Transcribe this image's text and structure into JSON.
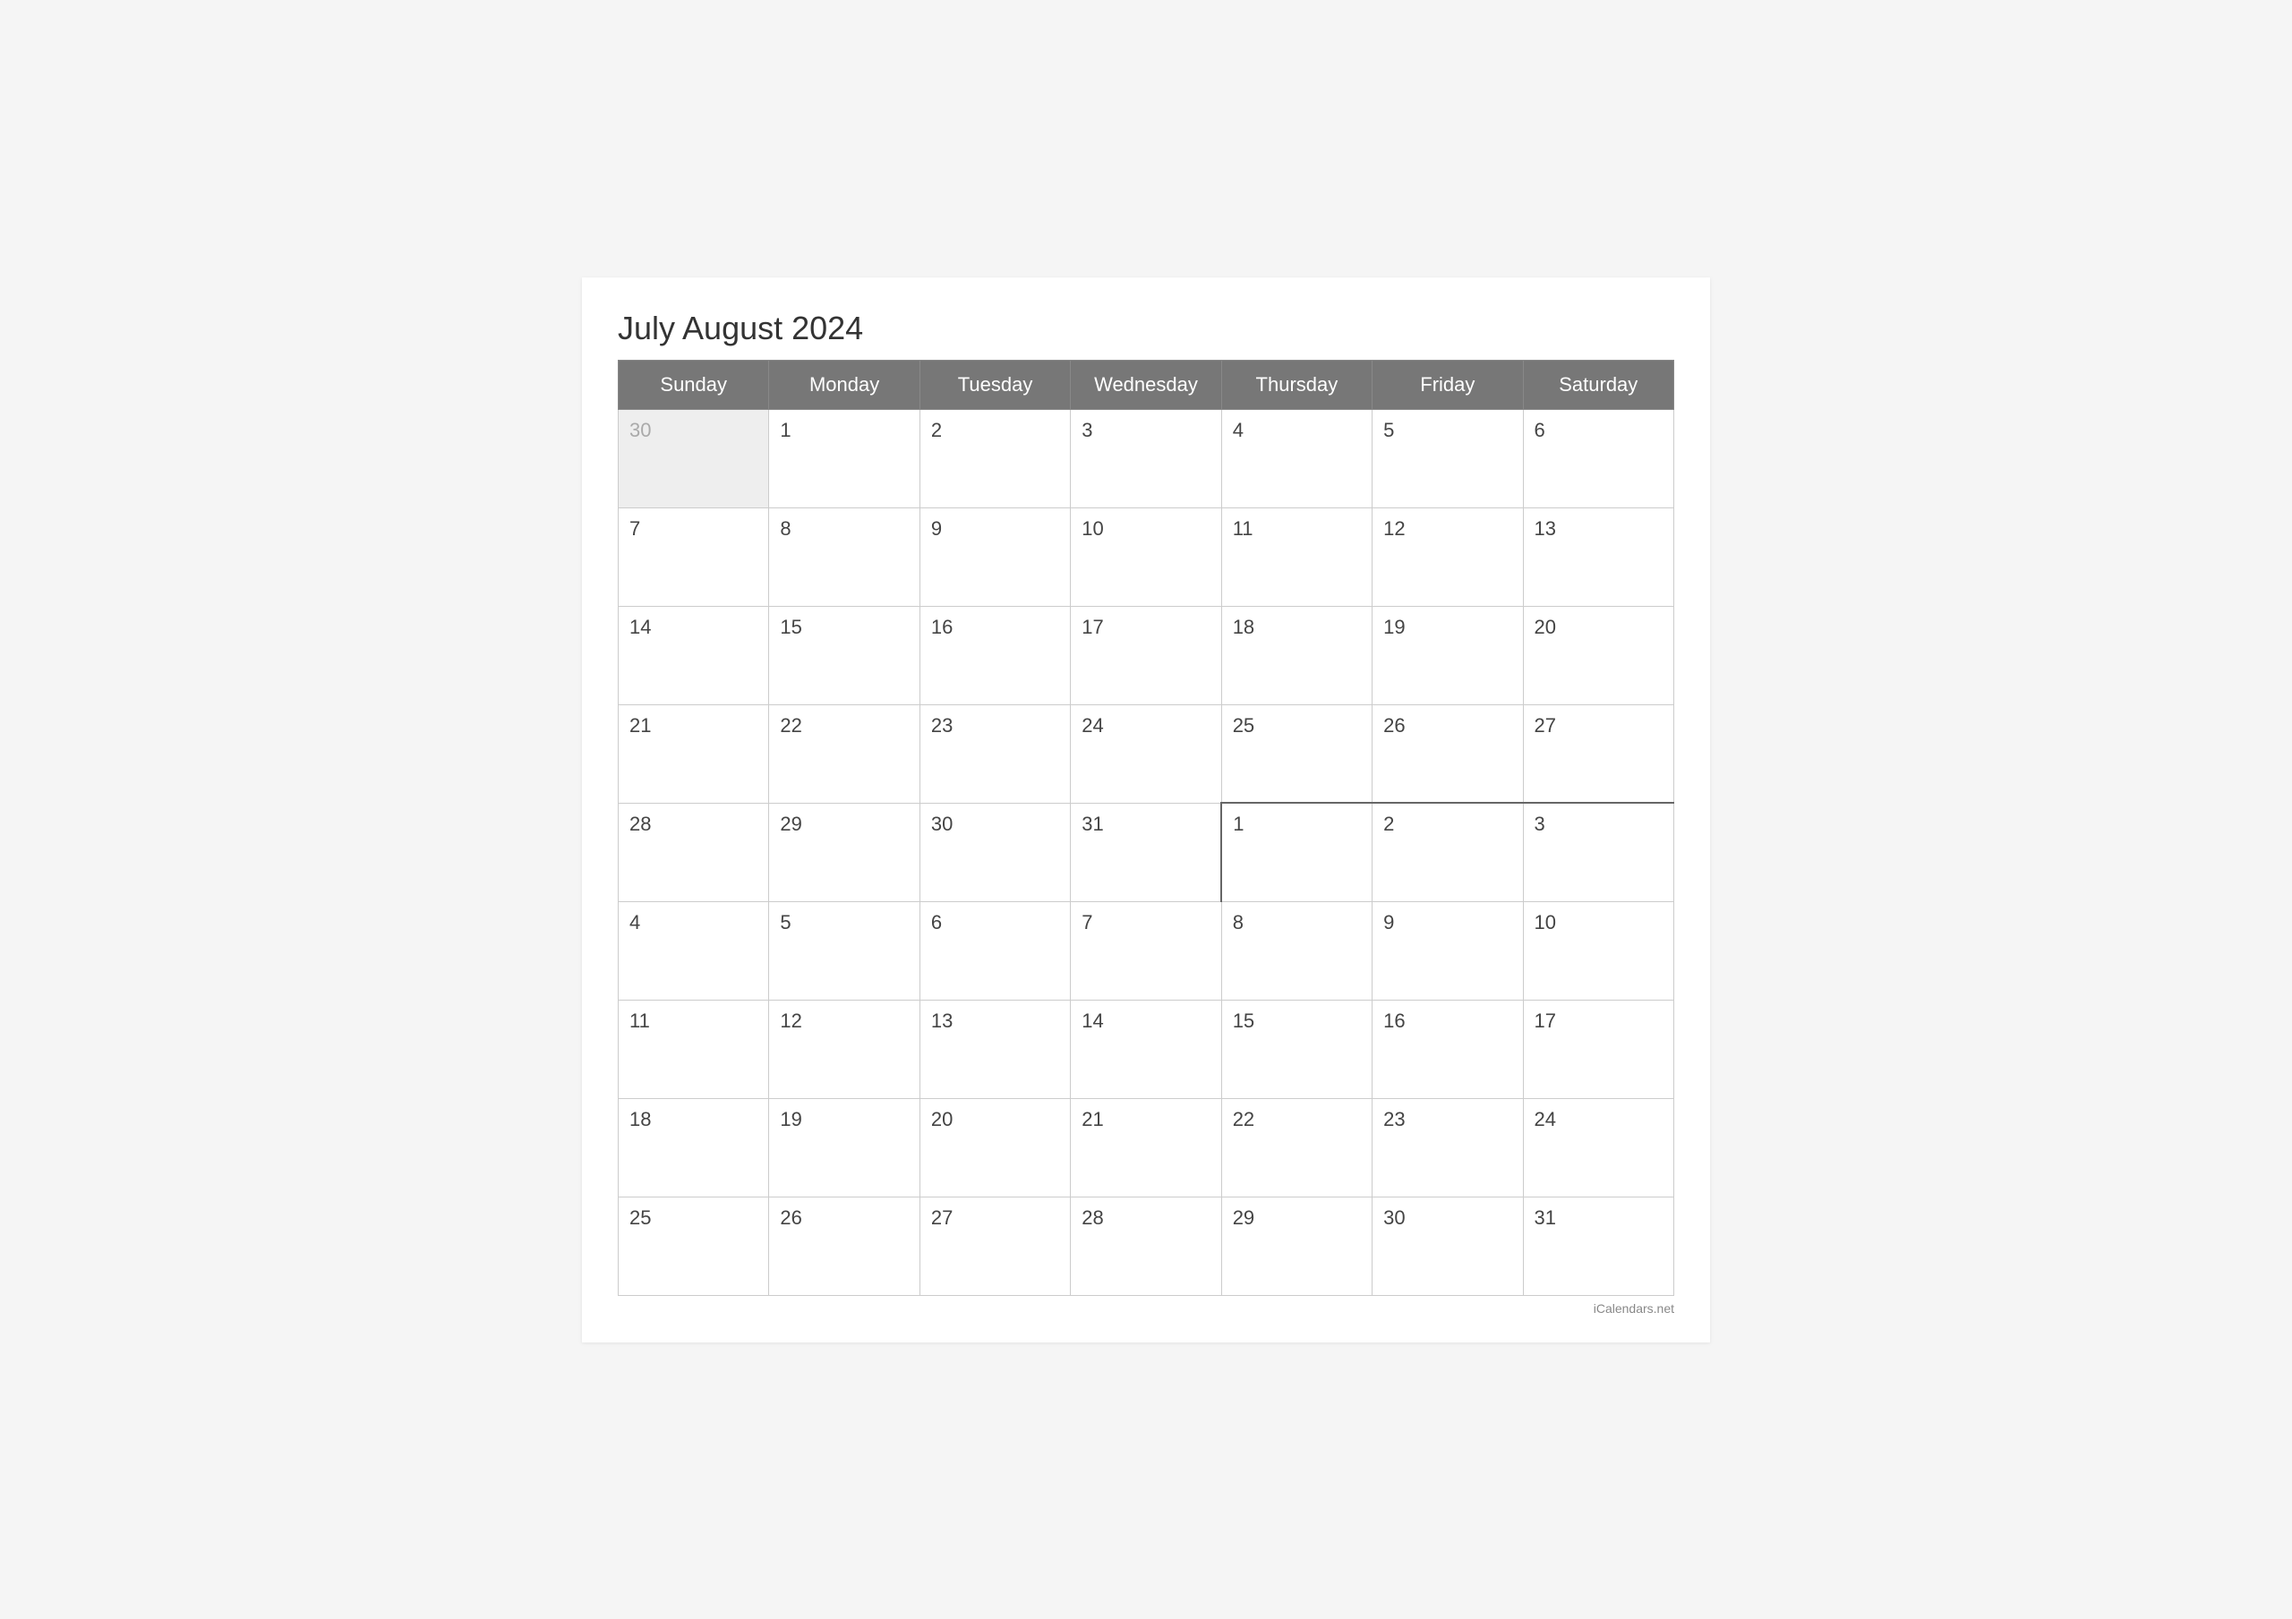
{
  "title": "July August 2024",
  "watermark": "iCalendars.net",
  "headers": [
    "Sunday",
    "Monday",
    "Tuesday",
    "Wednesday",
    "Thursday",
    "Friday",
    "Saturday"
  ],
  "weeks": [
    [
      {
        "day": "30",
        "type": "prev-month"
      },
      {
        "day": "1",
        "type": "current"
      },
      {
        "day": "2",
        "type": "current"
      },
      {
        "day": "3",
        "type": "current"
      },
      {
        "day": "4",
        "type": "current"
      },
      {
        "day": "5",
        "type": "current"
      },
      {
        "day": "6",
        "type": "current"
      }
    ],
    [
      {
        "day": "7",
        "type": "current"
      },
      {
        "day": "8",
        "type": "current"
      },
      {
        "day": "9",
        "type": "current"
      },
      {
        "day": "10",
        "type": "current"
      },
      {
        "day": "11",
        "type": "current"
      },
      {
        "day": "12",
        "type": "current"
      },
      {
        "day": "13",
        "type": "current"
      }
    ],
    [
      {
        "day": "14",
        "type": "current"
      },
      {
        "day": "15",
        "type": "current"
      },
      {
        "day": "16",
        "type": "current"
      },
      {
        "day": "17",
        "type": "current"
      },
      {
        "day": "18",
        "type": "current"
      },
      {
        "day": "19",
        "type": "current"
      },
      {
        "day": "20",
        "type": "current"
      }
    ],
    [
      {
        "day": "21",
        "type": "current"
      },
      {
        "day": "22",
        "type": "current"
      },
      {
        "day": "23",
        "type": "current"
      },
      {
        "day": "24",
        "type": "current"
      },
      {
        "day": "25",
        "type": "current"
      },
      {
        "day": "26",
        "type": "current"
      },
      {
        "day": "27",
        "type": "current"
      }
    ],
    [
      {
        "day": "28",
        "type": "current"
      },
      {
        "day": "29",
        "type": "current"
      },
      {
        "day": "30",
        "type": "current"
      },
      {
        "day": "31",
        "type": "current"
      },
      {
        "day": "1",
        "type": "next-month",
        "divider-top": true,
        "divider-left": true
      },
      {
        "day": "2",
        "type": "next-month",
        "divider-top": true
      },
      {
        "day": "3",
        "type": "next-month",
        "divider-top": true
      }
    ],
    [
      {
        "day": "4",
        "type": "next-month"
      },
      {
        "day": "5",
        "type": "next-month"
      },
      {
        "day": "6",
        "type": "next-month"
      },
      {
        "day": "7",
        "type": "next-month"
      },
      {
        "day": "8",
        "type": "next-month"
      },
      {
        "day": "9",
        "type": "next-month"
      },
      {
        "day": "10",
        "type": "next-month"
      }
    ],
    [
      {
        "day": "11",
        "type": "next-month"
      },
      {
        "day": "12",
        "type": "next-month"
      },
      {
        "day": "13",
        "type": "next-month"
      },
      {
        "day": "14",
        "type": "next-month"
      },
      {
        "day": "15",
        "type": "next-month"
      },
      {
        "day": "16",
        "type": "next-month"
      },
      {
        "day": "17",
        "type": "next-month"
      }
    ],
    [
      {
        "day": "18",
        "type": "next-month"
      },
      {
        "day": "19",
        "type": "next-month"
      },
      {
        "day": "20",
        "type": "next-month"
      },
      {
        "day": "21",
        "type": "next-month"
      },
      {
        "day": "22",
        "type": "next-month"
      },
      {
        "day": "23",
        "type": "next-month"
      },
      {
        "day": "24",
        "type": "next-month"
      }
    ],
    [
      {
        "day": "25",
        "type": "next-month"
      },
      {
        "day": "26",
        "type": "next-month"
      },
      {
        "day": "27",
        "type": "next-month"
      },
      {
        "day": "28",
        "type": "next-month"
      },
      {
        "day": "29",
        "type": "next-month"
      },
      {
        "day": "30",
        "type": "next-month"
      },
      {
        "day": "31",
        "type": "next-month"
      }
    ]
  ]
}
